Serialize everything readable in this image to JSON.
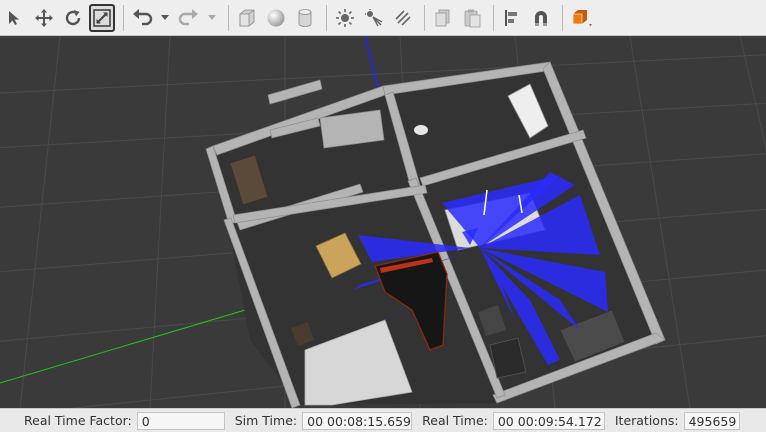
{
  "toolbar": {
    "icons": [
      "select-arrow-icon",
      "translate-icon",
      "rotate-icon",
      "scale-icon",
      "undo-icon",
      "undo-dropdown-icon",
      "redo-icon",
      "redo-dropdown-icon",
      "box-shape-icon",
      "sphere-shape-icon",
      "cylinder-shape-icon",
      "point-light-icon",
      "spot-light-icon",
      "directional-light-icon",
      "copy-icon",
      "paste-icon",
      "align-icon",
      "snap-icon",
      "view-angle-icon"
    ],
    "active_tool": "scale-icon",
    "accent_color": "#f07a10"
  },
  "statusbar": {
    "real_time_factor_label": "Real Time Factor:",
    "real_time_factor_value": "0",
    "sim_time_label": "Sim Time:",
    "sim_time_value": "00 00:08:15.659",
    "real_time_label": "Real Time:",
    "real_time_value": "00 00:09:54.172",
    "iterations_label": "Iterations:",
    "iterations_value": "495659"
  },
  "scene": {
    "laser_color": "#2a2aff",
    "floor_color": "#3a3a3a",
    "wall_color": "#b4b4b4"
  }
}
